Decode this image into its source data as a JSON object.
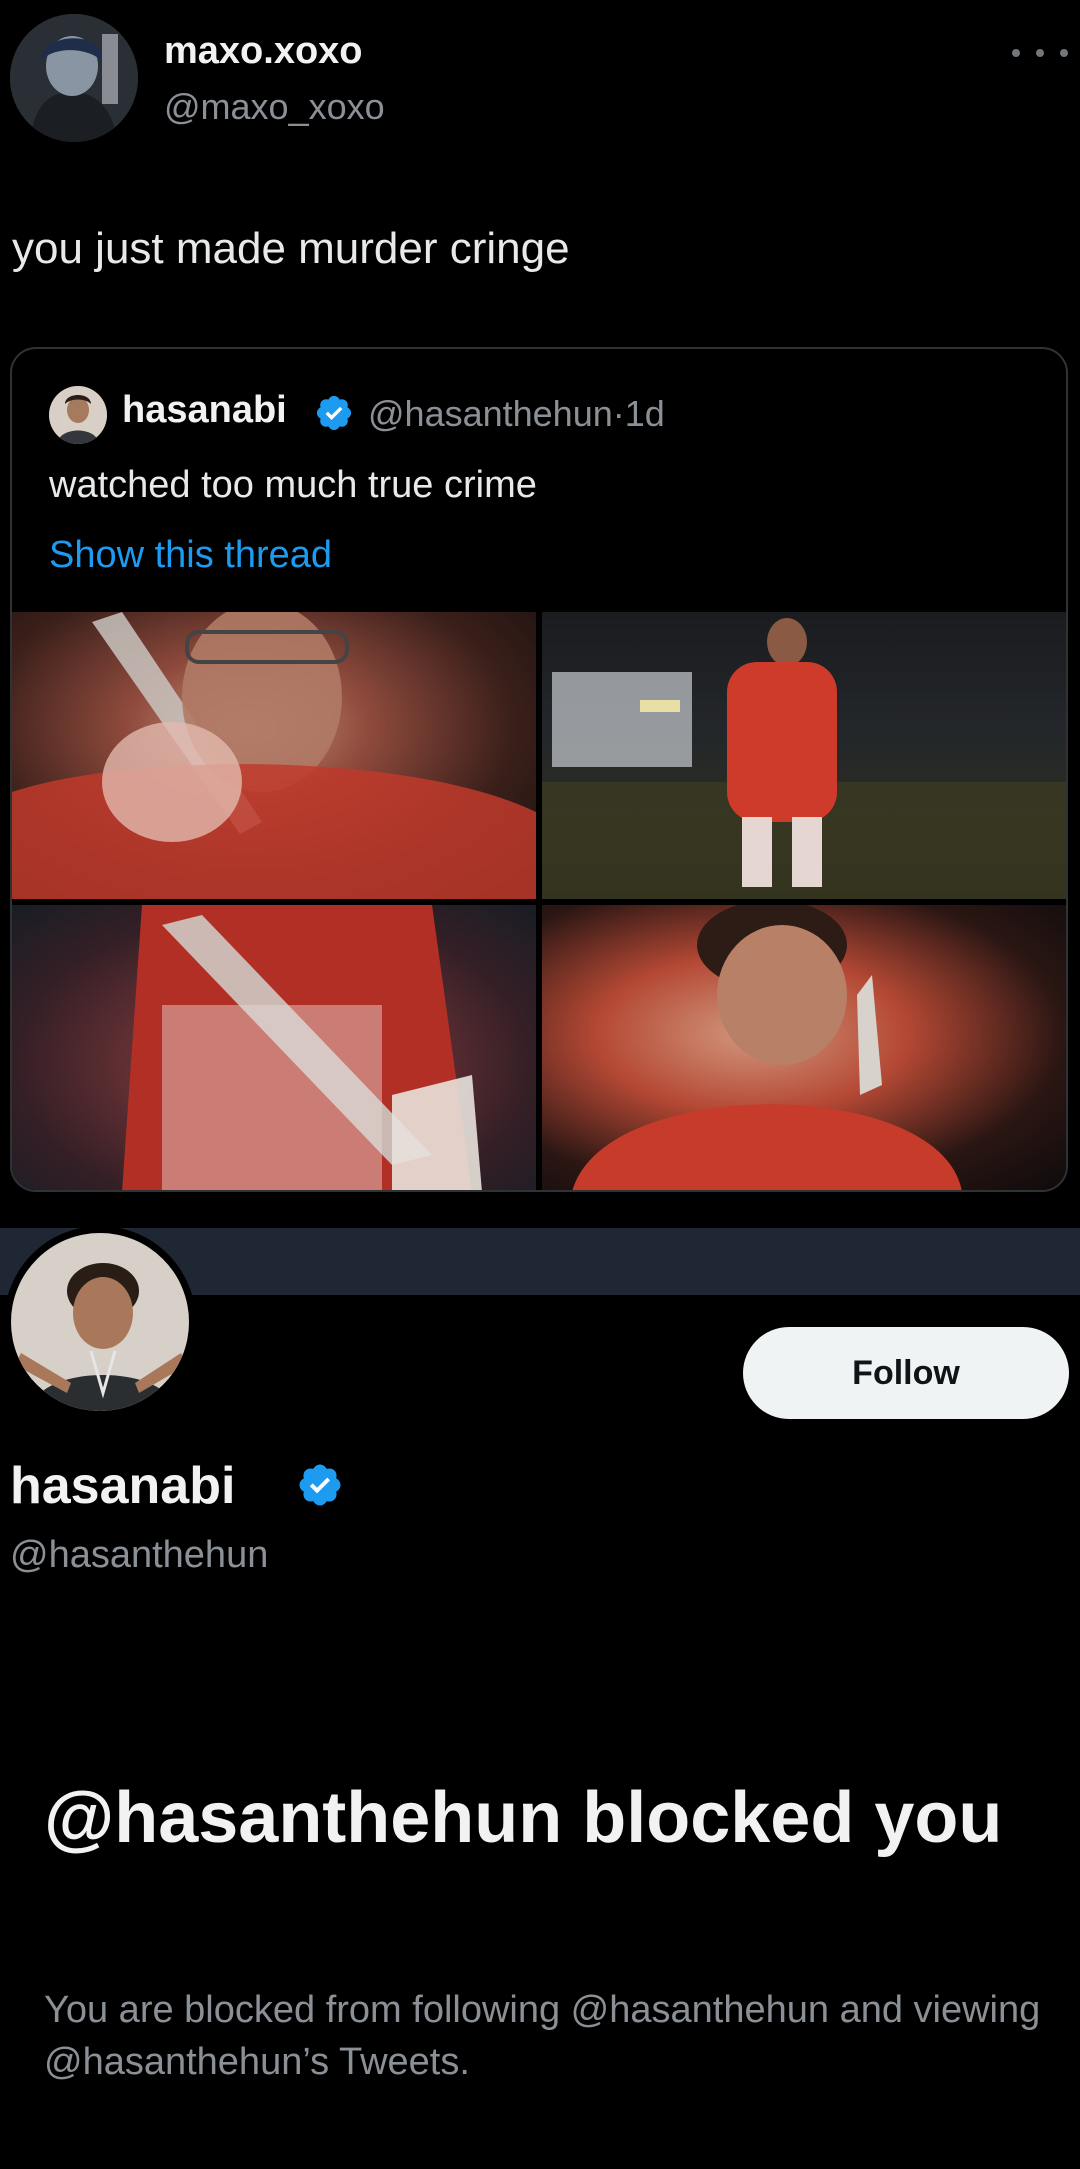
{
  "tweet": {
    "author_name": "maxo.xoxo",
    "author_handle": "@maxo_xoxo",
    "text": "you just made murder cringe",
    "more_icon": "more-horizontal-icon"
  },
  "quoted_tweet": {
    "author_name": "hasanabi",
    "author_handle": "@hasanthehun",
    "separator": "·",
    "time": "1d",
    "text": "watched too much true crime",
    "show_thread_label": "Show this thread",
    "verified_icon": "verified-badge-icon",
    "media_count": 4
  },
  "profile": {
    "name": "hasanabi",
    "handle": "@hasanthehun",
    "follow_label": "Follow",
    "verified_icon": "verified-badge-icon"
  },
  "blocked": {
    "title": "@hasanthehun blocked you",
    "description": "You are blocked from following @hasanthehun and viewing @hasanthehun’s Tweets."
  },
  "colors": {
    "background": "#000000",
    "link": "#1d9bf0",
    "verified": "#1d9bf0",
    "secondary_text": "#8b9096",
    "banner": "#1e2733",
    "follow_button_bg": "#eff3f4"
  }
}
